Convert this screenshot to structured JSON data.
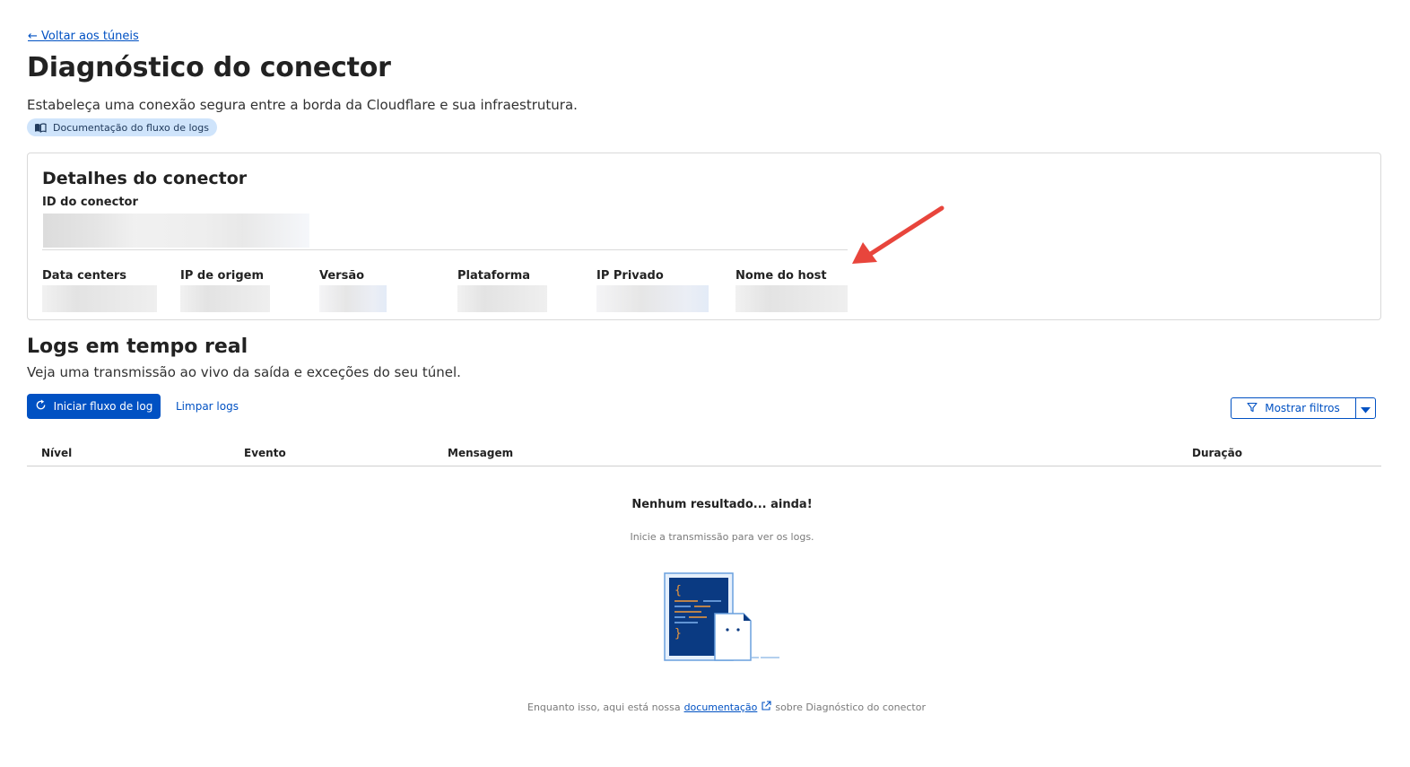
{
  "header": {
    "back_link": "← Voltar aos túneis",
    "title": "Diagnóstico do conector",
    "subtitle": "Estabeleça uma conexão segura entre a borda da Cloudflare e sua infraestrutura.",
    "doc_pill": "Documentação do fluxo de logs"
  },
  "connector": {
    "title": "Detalhes do conector",
    "id_label": "ID do conector",
    "fields": [
      {
        "label": "Data centers"
      },
      {
        "label": "IP de origem"
      },
      {
        "label": "Versão"
      },
      {
        "label": "Plataforma"
      },
      {
        "label": "IP Privado"
      },
      {
        "label": "Nome do host"
      }
    ]
  },
  "logs": {
    "title": "Logs em tempo real",
    "subtitle": "Veja uma transmissão ao vivo da saída e exceções do seu túnel.",
    "start_button": "Iniciar fluxo de log",
    "clear_link": "Limpar logs",
    "filter_button": "Mostrar filtros",
    "columns": [
      "Nível",
      "Evento",
      "Mensagem",
      "Duração"
    ],
    "empty_title": "Nenhum resultado... ainda!",
    "empty_hint": "Inicie a transmissão para ver os logs."
  },
  "footer": {
    "prefix": "Enquanto isso, aqui está nossa",
    "link": "documentação",
    "suffix": "sobre Diagnóstico do conector"
  },
  "icons": {
    "book": "book-icon",
    "refresh": "refresh-icon",
    "filter": "filter-icon",
    "caret": "caret-down-icon",
    "external": "external-link-icon"
  },
  "colors": {
    "accent": "#0051c3",
    "pill_bg": "#cfe4fb",
    "arrow": "#e8453c"
  }
}
